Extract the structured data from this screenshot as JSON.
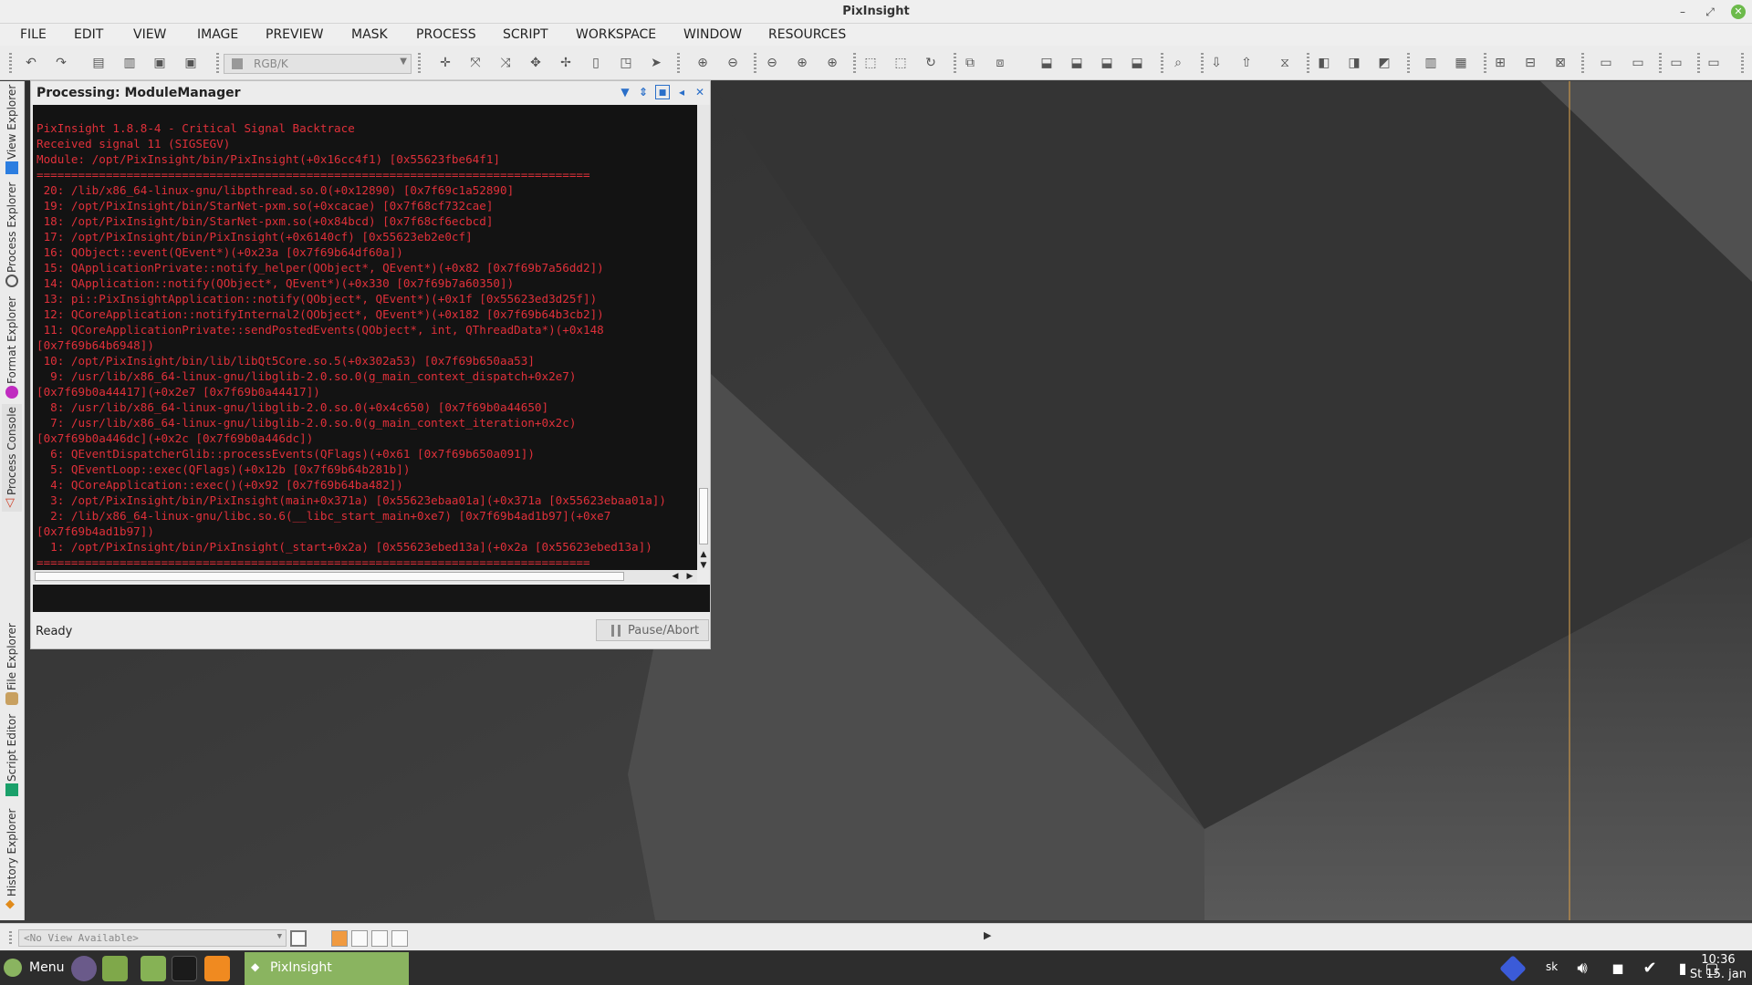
{
  "window": {
    "title": "PixInsight"
  },
  "menu": [
    "FILE",
    "EDIT",
    "VIEW",
    "IMAGE",
    "PREVIEW",
    "MASK",
    "PROCESS",
    "SCRIPT",
    "WORKSPACE",
    "WINDOW",
    "RESOURCES"
  ],
  "toolbar": {
    "color_space": "RGB/K"
  },
  "left_dock": {
    "tabs": [
      "View Explorer",
      "Process Explorer",
      "Format Explorer",
      "Process Console",
      "File Explorer",
      "Script Editor",
      "History Explorer"
    ]
  },
  "console": {
    "title": "Processing: ModuleManager",
    "lines": [
      "PixInsight 1.8.8-4 - Critical Signal Backtrace",
      "Received signal 11 (SIGSEGV)",
      "Module: /opt/PixInsight/bin/PixInsight(+0x16cc4f1) [0x55623fbe64f1]",
      "================================================================================",
      " 20: /lib/x86_64-linux-gnu/libpthread.so.0(+0x12890) [0x7f69c1a52890]",
      " 19: /opt/PixInsight/bin/StarNet-pxm.so(+0xcacae) [0x7f68cf732cae]",
      " 18: /opt/PixInsight/bin/StarNet-pxm.so(+0x84bcd) [0x7f68cf6ecbcd]",
      " 17: /opt/PixInsight/bin/PixInsight(+0x6140cf) [0x55623eb2e0cf]",
      " 16: QObject::event(QEvent*)(+0x23a [0x7f69b64df60a])",
      " 15: QApplicationPrivate::notify_helper(QObject*, QEvent*)(+0x82 [0x7f69b7a56dd2])",
      " 14: QApplication::notify(QObject*, QEvent*)(+0x330 [0x7f69b7a60350])",
      " 13: pi::PixInsightApplication::notify(QObject*, QEvent*)(+0x1f [0x55623ed3d25f])",
      " 12: QCoreApplication::notifyInternal2(QObject*, QEvent*)(+0x182 [0x7f69b64b3cb2])",
      " 11: QCoreApplicationPrivate::sendPostedEvents(QObject*, int, QThreadData*)(+0x148",
      "[0x7f69b64b6948])",
      " 10: /opt/PixInsight/bin/lib/libQt5Core.so.5(+0x302a53) [0x7f69b650aa53]",
      "  9: /usr/lib/x86_64-linux-gnu/libglib-2.0.so.0(g_main_context_dispatch+0x2e7)",
      "[0x7f69b0a44417](+0x2e7 [0x7f69b0a44417])",
      "  8: /usr/lib/x86_64-linux-gnu/libglib-2.0.so.0(+0x4c650) [0x7f69b0a44650]",
      "  7: /usr/lib/x86_64-linux-gnu/libglib-2.0.so.0(g_main_context_iteration+0x2c)",
      "[0x7f69b0a446dc](+0x2c [0x7f69b0a446dc])",
      "  6: QEventDispatcherGlib::processEvents(QFlags)(+0x61 [0x7f69b650a091])",
      "  5: QEventLoop::exec(QFlags)(+0x12b [0x7f69b64b281b])",
      "  4: QCoreApplication::exec()(+0x92 [0x7f69b64ba482])",
      "  3: /opt/PixInsight/bin/PixInsight(main+0x371a) [0x55623ebaa01a](+0x371a [0x55623ebaa01a])",
      "  2: /lib/x86_64-linux-gnu/libc.so.6(__libc_start_main+0xe7) [0x7f69b4ad1b97](+0xe7",
      "[0x7f69b4ad1b97])",
      "  1: /opt/PixInsight/bin/PixInsight(_start+0x2a) [0x55623ebed13a](+0x2a [0x55623ebed13a])",
      "================================================================================"
    ],
    "status": "Ready",
    "pause_label": "Pause/Abort"
  },
  "viewbar": {
    "view_select": "<No View Available>"
  },
  "taskbar": {
    "menu_label": "Menu",
    "active_app": "PixInsight",
    "keyboard": "sk",
    "time": "10:36",
    "date": "St 15. jan"
  },
  "colors": {
    "console_text": "#e0303a",
    "console_bg": "#131313",
    "taskbar_active": "#8ab460",
    "workspace_bg": "#3e3e3e"
  }
}
